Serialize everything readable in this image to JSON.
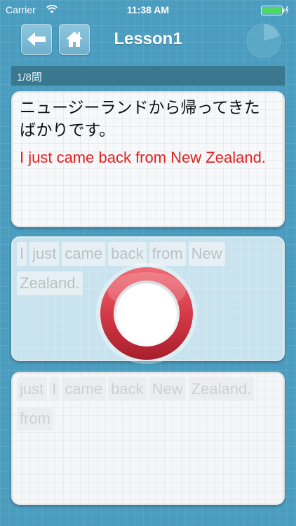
{
  "status": {
    "carrier": "Carrier",
    "time": "11:38 AM"
  },
  "nav": {
    "title": "Lesson1",
    "back_icon": "arrow-left-icon",
    "home_icon": "home-icon",
    "timer_icon": "pie-timer-icon"
  },
  "progress": {
    "label": "1/8問"
  },
  "question": {
    "japanese": "ニュージーランドから帰ってきたばかりです。",
    "english": "I just came back from New Zealand."
  },
  "answer": {
    "words": [
      "I",
      "just",
      "came",
      "back",
      "from",
      "New",
      "Zealand."
    ]
  },
  "choices": {
    "words": [
      "just",
      "I",
      "came",
      "back",
      "New",
      "Zealand.",
      "from"
    ]
  },
  "feedback": {
    "icon": "correct-circle-icon"
  },
  "colors": {
    "background": "#4b9dc0",
    "progress_bg": "#39788f",
    "english_text": "#e32020",
    "ring_red": "#d63a48"
  }
}
